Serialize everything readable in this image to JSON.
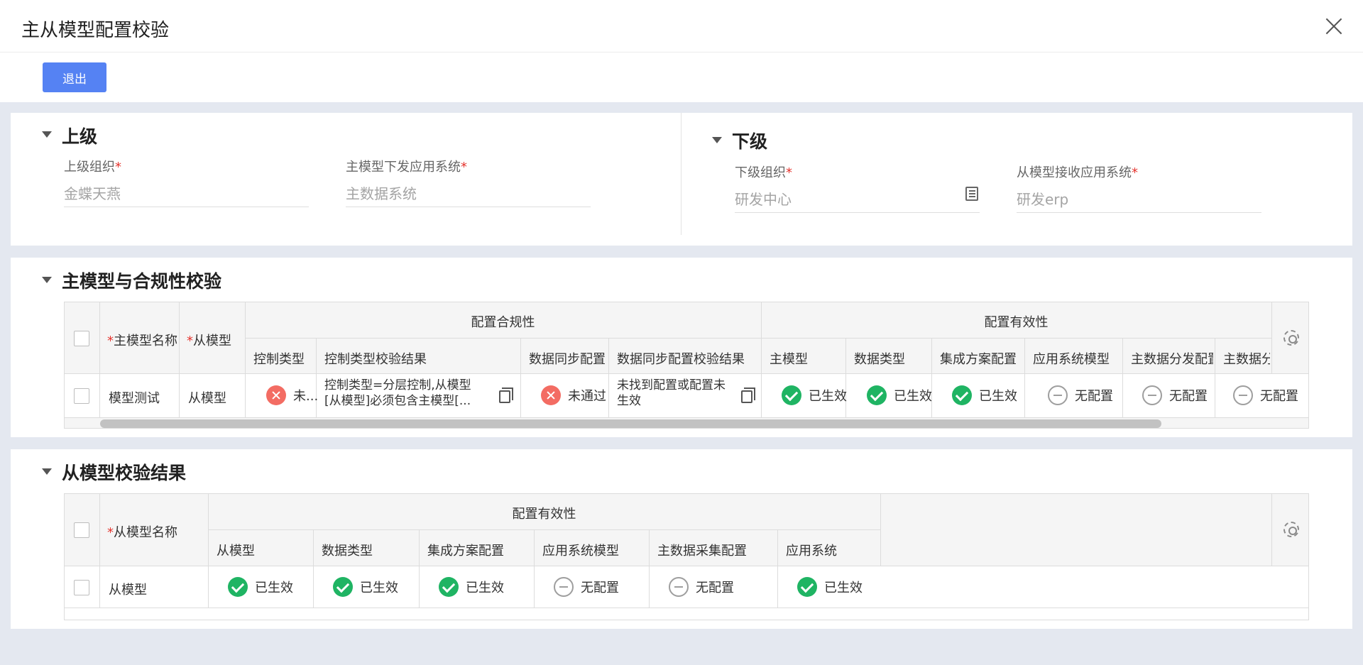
{
  "header": {
    "title": "主从模型配置校验"
  },
  "toolbar": {
    "exit_label": "退出"
  },
  "upper": {
    "title": "上级",
    "org_label": "上级组织",
    "org_value": "金蝶天燕",
    "sys_label": "主模型下发应用系统",
    "sys_value": "主数据系统"
  },
  "lower": {
    "title": "下级",
    "org_label": "下级组织",
    "org_value": "研发中心",
    "sys_label": "从模型接收应用系统",
    "sys_value": "研发erp"
  },
  "section2": {
    "title": "主模型与合规性校验",
    "group_compliance": "配置合规性",
    "group_validity": "配置有效性",
    "col_main_name": "主模型名称",
    "col_sub": "从模型",
    "cols": [
      "控制类型",
      "控制类型校验结果",
      "数据同步配置",
      "数据同步配置校验结果",
      "主模型",
      "数据类型",
      "集成方案配置",
      "应用系统模型",
      "主数据分发配置",
      "主数据分"
    ],
    "row": {
      "main_name": "模型测试",
      "sub": "从模型",
      "control_type_status": "未...",
      "control_result": "控制类型=分层控制,从模型[从模型]必须包含主模型[...",
      "sync_status": "未通过",
      "sync_result": "未找到配置或配置未生效",
      "main_model": "已生效",
      "data_type": "已生效",
      "integration": "已生效",
      "app_model": "无配置",
      "dist": "无配置",
      "last": "无配置"
    }
  },
  "section3": {
    "title": "从模型校验结果",
    "group_validity": "配置有效性",
    "col_sub_name": "从模型名称",
    "cols": [
      "从模型",
      "数据类型",
      "集成方案配置",
      "应用系统模型",
      "主数据采集配置",
      "应用系统"
    ],
    "row": {
      "name": "从模型",
      "c1": "已生效",
      "c2": "已生效",
      "c3": "已生效",
      "c4": "无配置",
      "c5": "无配置",
      "c6": "已生效"
    }
  },
  "colors": {
    "primary": "#5582f3",
    "success": "#1fb463",
    "danger": "#f36c63",
    "required": "#e5342e"
  }
}
